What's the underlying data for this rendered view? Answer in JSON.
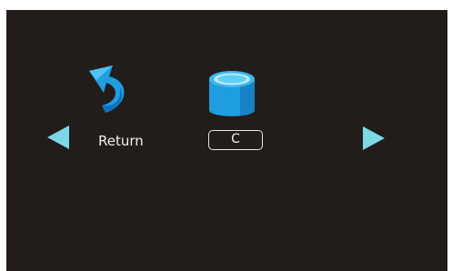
{
  "menu": {
    "items": [
      {
        "label": "Return",
        "icon": "return-arrow-icon"
      },
      {
        "label": "C",
        "icon": "drive-icon",
        "selected": true
      }
    ],
    "left_arrow_icon": "chevron-left-icon",
    "right_arrow_icon": "chevron-right-icon"
  },
  "colors": {
    "background": "#221c1a",
    "accent": "#7dd8e6",
    "icon_blue": "#1e9ee0",
    "text": "#f2f2f2"
  }
}
